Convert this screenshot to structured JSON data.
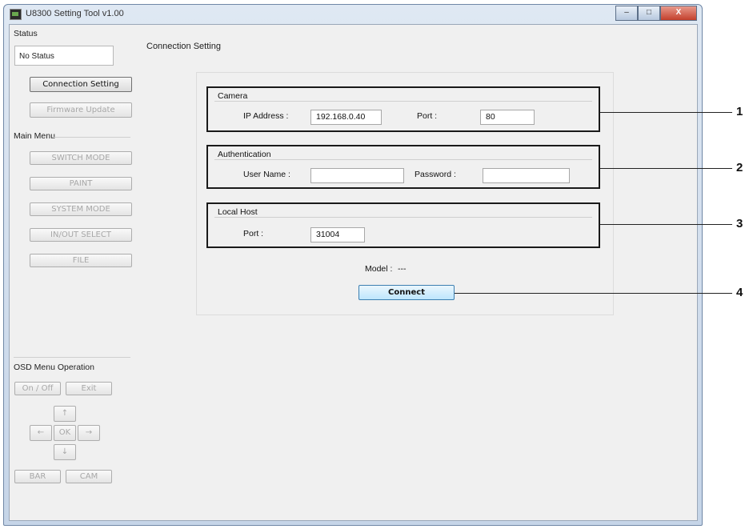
{
  "window": {
    "title": "U8300 Setting Tool v1.00",
    "minimize": "–",
    "maximize": "□",
    "close": "X"
  },
  "sidebar": {
    "status_label": "Status",
    "status_value": "No Status",
    "connection_setting": "Connection Setting",
    "firmware_update": "Firmware Update",
    "main_menu_label": "Main Menu",
    "switch_mode": "SWITCH MODE",
    "paint": "PAINT",
    "system_mode": "SYSTEM MODE",
    "in_out_select": "IN/OUT SELECT",
    "file": "FILE",
    "osd_label": "OSD Menu Operation",
    "osd": {
      "on_off": "On / Off",
      "exit": "Exit",
      "up": "↑",
      "left": "←",
      "ok": "OK",
      "right": "→",
      "down": "↓",
      "bar": "BAR",
      "cam": "CAM"
    }
  },
  "main": {
    "title": "Connection Setting",
    "camera": {
      "title": "Camera",
      "ip_label": "IP Address :",
      "ip_value": "192.168.0.40",
      "port_label": "Port :",
      "port_value": "80"
    },
    "authentication": {
      "title": "Authentication",
      "user_label": "User Name :",
      "user_value": "",
      "password_label": "Password :",
      "password_value": ""
    },
    "local_host": {
      "title": "Local Host",
      "port_label": "Port :",
      "port_value": "31004"
    },
    "model_label": "Model :",
    "model_value": "---",
    "connect": "Connect"
  },
  "callouts": [
    "1",
    "2",
    "3",
    "4"
  ]
}
